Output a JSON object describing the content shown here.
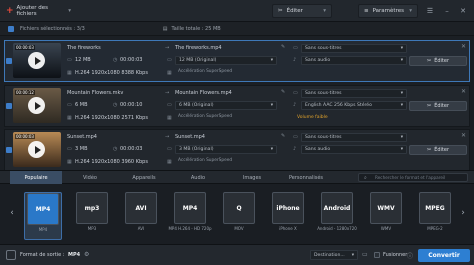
{
  "toolbar": {
    "add_files_label": "Ajouter des fichiers",
    "edit_label": "Éditer",
    "settings_label": "Paramètres"
  },
  "summary": {
    "selected_label": "Fichiers sélectionnés : 3/3",
    "total_size_label": "Taille totale : 25 MB"
  },
  "files": [
    {
      "duration": "00:00:03",
      "name": "The fireworks",
      "output_name": "The fireworks.mp4",
      "size": "12 MB",
      "duration2": "00:00:03",
      "info": "H.264 1920x1080 8388 Kbps",
      "output_size": "12 MB (Original)",
      "output_info": "H.264 1920x1080 8388 Kbps",
      "subtitles": "Sans sous-titres",
      "audio": "Sans audio",
      "accel": "Accélération SuperSpeed",
      "extra": "",
      "edit_label": "Éditer",
      "selected": true,
      "thumb_colors": [
        "#3a4450",
        "#0d1116"
      ]
    },
    {
      "duration": "00:00:12",
      "name": "Mountain Flowers.mkv",
      "output_name": "Mountain Flowers.mp4",
      "size": "6 MB",
      "duration2": "00:00:10",
      "info": "H.264 1920x1080 2571 Kbps",
      "output_size": "6 MB (Original)",
      "output_info": "H.264 1920x1080 2571 Kbps",
      "subtitles": "Sans sous-titres",
      "audio": "English AAC 256 Kbps Stéréo",
      "accel": "Accélération SuperSpeed",
      "extra": "Volume faible",
      "edit_label": "Éditer",
      "selected": false,
      "thumb_colors": [
        "#6a5a46",
        "#2f2a22"
      ]
    },
    {
      "duration": "00:00:03",
      "name": "Sunset.mp4",
      "output_name": "Sunset.mp4",
      "size": "3 MB",
      "duration2": "00:00:03",
      "info": "H.264 1920x1080 3960 Kbps",
      "output_size": "3 MB (Original)",
      "output_info": "H.264 1920x1080 3960 Kbps",
      "subtitles": "Sans sous-titres",
      "audio": "Sans audio",
      "accel": "Accélération SuperSpeed",
      "extra": "",
      "edit_label": "Éditer",
      "selected": false,
      "thumb_colors": [
        "#b88a55",
        "#3b2a1c"
      ]
    }
  ],
  "tabs": [
    "Populaire",
    "Vidéo",
    "Appareils",
    "Audio",
    "Images",
    "Personnalisés"
  ],
  "search_placeholder": "Rechercher le format et l'appareil",
  "formats": [
    {
      "icon": "MP4",
      "label": "MP4",
      "color": "#2a78c8",
      "active": true
    },
    {
      "icon": "mp3",
      "label": "MP3",
      "color": "#2a2f35"
    },
    {
      "icon": "AVI",
      "label": "AVI",
      "color": "#2a2f35"
    },
    {
      "icon": "MP4",
      "label": "MP4 H.264 - HD 720p",
      "color": "#2a2f35"
    },
    {
      "icon": "Q",
      "label": "MOV",
      "color": "#2a2f35"
    },
    {
      "icon": "iPhone",
      "label": "iPhone X",
      "color": "#2a2f35"
    },
    {
      "icon": "Android",
      "label": "Android - 1280x720",
      "color": "#2a2f35"
    },
    {
      "icon": "WMV",
      "label": "WMV",
      "color": "#2a2f35"
    },
    {
      "icon": "MPEG",
      "label": "MPEG-2",
      "color": "#2a2f35"
    }
  ],
  "bottom": {
    "output_format_label": "Format de sortie :",
    "output_format_value": "MP4",
    "destination_label": "Destination...",
    "merge_label": "Fusionner",
    "convert_label": "Convertir"
  }
}
